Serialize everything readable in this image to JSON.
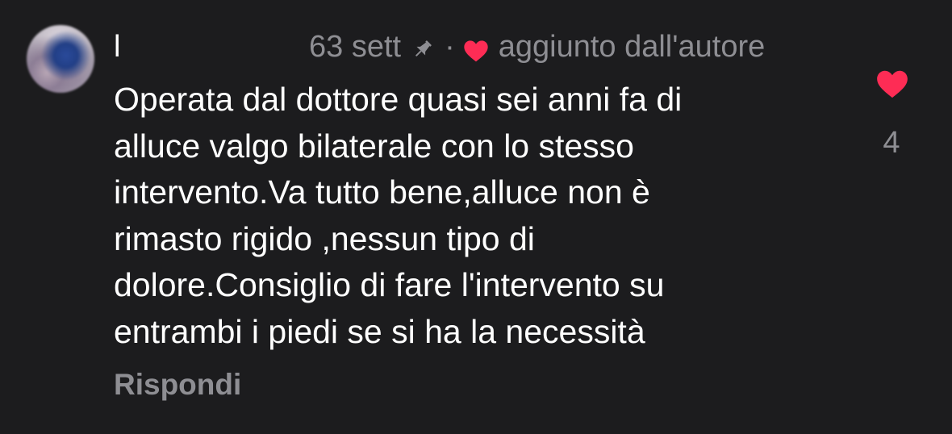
{
  "comment": {
    "author": {
      "name": "l",
      "avatar": "avatar"
    },
    "time": "63 sett",
    "separator": "·",
    "pinned_icon": "pin-icon",
    "author_like_icon": "heart-icon",
    "author_like_text": "aggiunto dall'autore",
    "text": "Operata dal dottore  quasi sei anni fa di\nalluce valgo bilaterale con lo stesso\nintervento.Va tutto bene,alluce non è\nrimasto rigido ,nessun tipo di\ndolore.Consiglio di fare l'intervento  su\nentrambi i piedi  se si ha la necessità",
    "reply_label": "Rispondi",
    "like": {
      "icon": "heart-icon",
      "count": "4",
      "liked": true
    }
  },
  "colors": {
    "background": "#1c1c1e",
    "text_primary": "#ffffff",
    "text_secondary": "#8e8e93",
    "heart": "#fe2c55"
  }
}
